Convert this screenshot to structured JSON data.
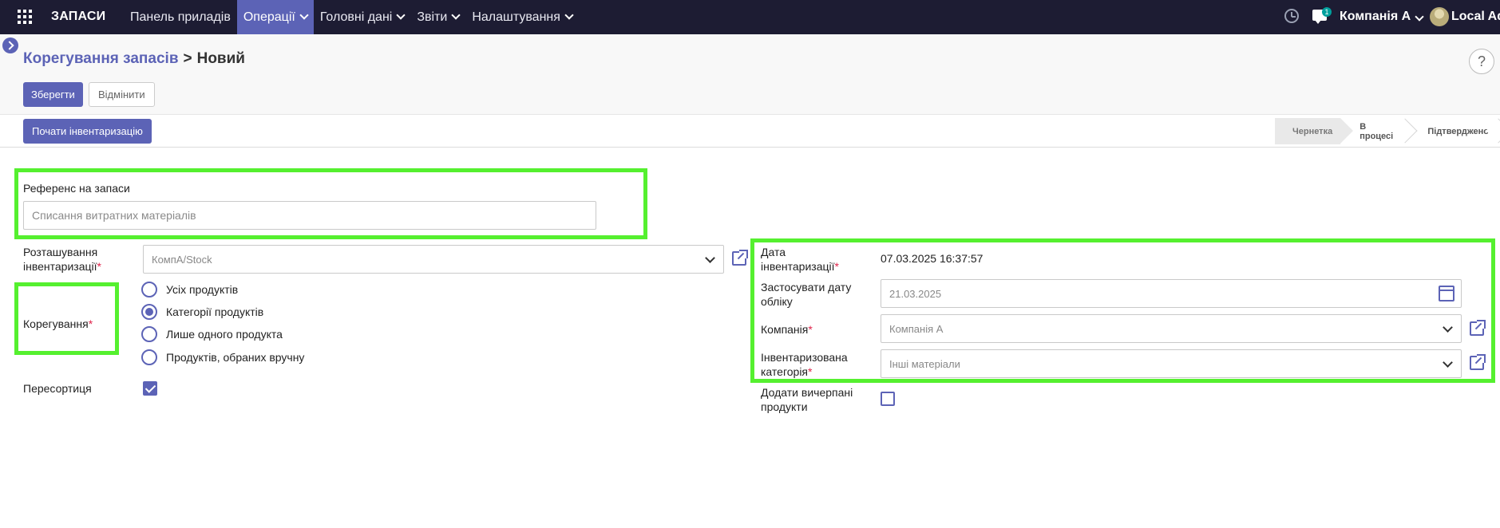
{
  "navbar": {
    "app_name": "ЗАПАСИ",
    "menu": [
      {
        "label": "Панель приладів",
        "has_dropdown": false
      },
      {
        "label": "Операції",
        "has_dropdown": true,
        "active": true
      },
      {
        "label": "Головні дані",
        "has_dropdown": true
      },
      {
        "label": "Звіти",
        "has_dropdown": true
      },
      {
        "label": "Налаштування",
        "has_dropdown": true
      }
    ],
    "chat_count": "1",
    "company": "Компанія А",
    "user": "Local Adr",
    "accent_color": "#5c63b6",
    "bar_color": "#1d1c33"
  },
  "control_panel": {
    "breadcrumb_parent": "Корегування запасів",
    "breadcrumb_separator": ">",
    "breadcrumb_current": "Новий",
    "save_label": "Зберегти",
    "discard_label": "Відмінити",
    "help_label": "?"
  },
  "statusbar": {
    "start_label": "Почати інвентаризацію",
    "stages": [
      "Чернетка",
      "В процесі",
      "Підтверджено"
    ],
    "active_stage": "Чернетка"
  },
  "form": {
    "reference_label": "Референс на запаси",
    "reference_placeholder": "Списання витратних матеріалів",
    "location_label_1": "Розташування",
    "location_label_2": "інвентаризації",
    "location_value": "КомпА/Stock",
    "adjustment_label": "Корегування",
    "adjustment_options": [
      "Усіх продуктів",
      "Категорії продуктів",
      "Лише одного продукта",
      "Продуктів, обраних вручну"
    ],
    "adjustment_selected": 1,
    "resort_label": "Пересортиця",
    "resort_checked": true,
    "date_label_1": "Дата",
    "date_label_2": "інвентаризації",
    "date_value": "07.03.2025 16:37:57",
    "accounting_date_label_1": "Застосувати дату",
    "accounting_date_label_2": "обліку",
    "accounting_date_value": "21.03.2025",
    "company_label": "Компанія",
    "company_value": "Компанія А",
    "category_label_1": "Інвентаризована",
    "category_label_2": "категорія",
    "category_value": "Інші матеріали",
    "exhausted_label_1": "Додати вичерпані",
    "exhausted_label_2": "продукти",
    "exhausted_checked": false,
    "required_mark": "*",
    "highlight_color": "#55f02f"
  }
}
